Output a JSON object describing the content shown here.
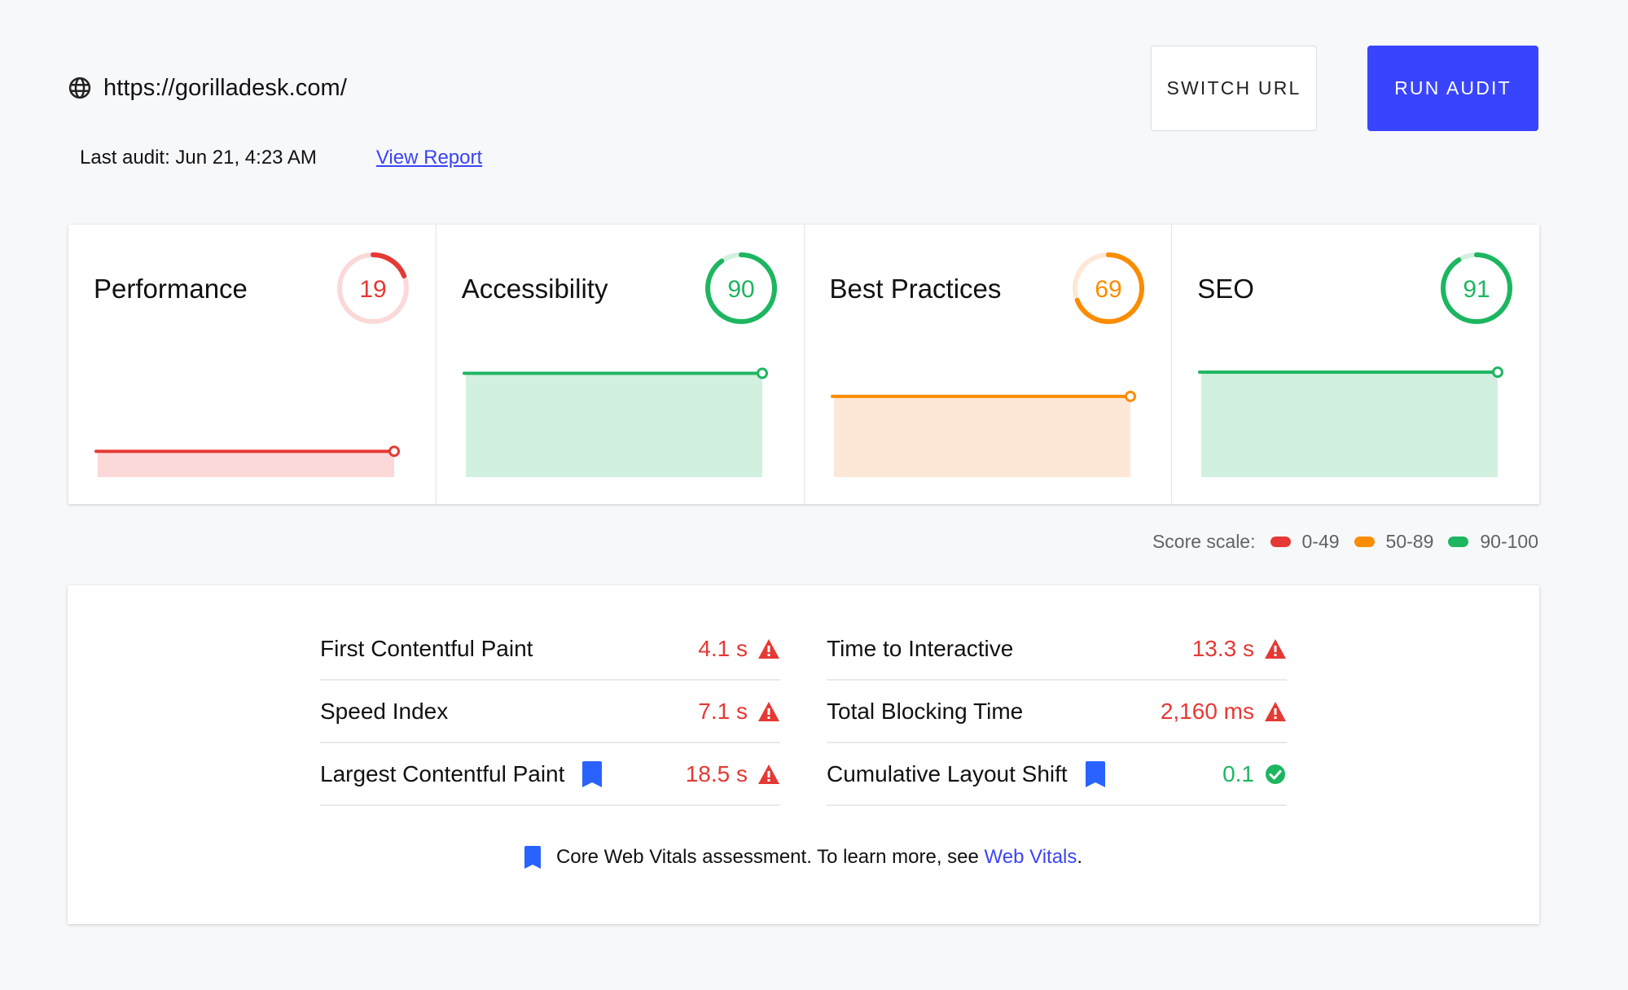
{
  "header": {
    "url": "https://gorilladesk.com/",
    "url_icon": "globe-icon",
    "last_audit": "Last audit: Jun 21, 4:23 AM",
    "view_report_label": "View Report",
    "switch_url_label": "SWITCH URL",
    "run_audit_label": "RUN AUDIT"
  },
  "colors": {
    "red": "#e53935",
    "red_light": "#fbd9d9",
    "orange": "#fb8c00",
    "orange_light": "#fde7d6",
    "green": "#1db660",
    "green_light": "#d2f0e0",
    "accent": "#3944ff",
    "link": "#3b44f6",
    "bookmark_blue": "#2962ff"
  },
  "categories": [
    {
      "title": "Performance",
      "score": 19,
      "level": "red"
    },
    {
      "title": "Accessibility",
      "score": 90,
      "level": "green"
    },
    {
      "title": "Best Practices",
      "score": 69,
      "level": "orange"
    },
    {
      "title": "SEO",
      "score": 91,
      "level": "green"
    }
  ],
  "score_scale": {
    "label": "Score scale:",
    "ranges": [
      {
        "label": "0-49",
        "level": "red"
      },
      {
        "label": "50-89",
        "level": "orange"
      },
      {
        "label": "90-100",
        "level": "green"
      }
    ]
  },
  "metrics": {
    "left": [
      {
        "label": "First Contentful Paint",
        "value": "4.1 s",
        "status": "fail",
        "core_web_vital": false
      },
      {
        "label": "Speed Index",
        "value": "7.1 s",
        "status": "fail",
        "core_web_vital": false
      },
      {
        "label": "Largest Contentful Paint",
        "value": "18.5 s",
        "status": "fail",
        "core_web_vital": true
      }
    ],
    "right": [
      {
        "label": "Time to Interactive",
        "value": "13.3 s",
        "status": "fail",
        "core_web_vital": false
      },
      {
        "label": "Total Blocking Time",
        "value": "2,160 ms",
        "status": "fail",
        "core_web_vital": false
      },
      {
        "label": "Cumulative Layout Shift",
        "value": "0.1",
        "status": "pass",
        "core_web_vital": true
      }
    ]
  },
  "footnote": {
    "text": "Core Web Vitals assessment. To learn more, see ",
    "link_label": "Web Vitals",
    "suffix": "."
  }
}
